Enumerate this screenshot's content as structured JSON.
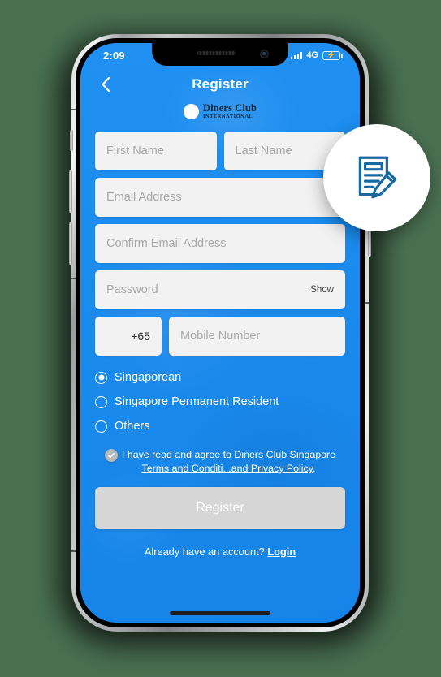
{
  "status_bar": {
    "time": "2:09",
    "network": "4G",
    "signal_icon": "signal-bars-icon",
    "battery_icon": "battery-charging-icon"
  },
  "nav": {
    "back_icon": "chevron-left-icon",
    "title": "Register"
  },
  "brand": {
    "logo_icon": "diners-club-split-circle-icon",
    "name": "Diners Club",
    "subtitle": "INTERNATIONAL"
  },
  "form": {
    "first_name_placeholder": "First Name",
    "last_name_placeholder": "Last Name",
    "email_placeholder": "Email Address",
    "confirm_email_placeholder": "Confirm Email Address",
    "password_placeholder": "Password",
    "show_password_label": "Show",
    "country_code": "+65",
    "mobile_placeholder": "Mobile Number"
  },
  "residency": {
    "options": [
      {
        "label": "Singaporean",
        "selected": true
      },
      {
        "label": "Singapore Permanent Resident",
        "selected": false
      },
      {
        "label": "Others",
        "selected": false
      }
    ]
  },
  "terms": {
    "checkbox_icon": "check-icon",
    "checked": true,
    "line1": "I have read and agree to Diners Club Singapore",
    "link": "Terms and Conditi...and Privacy Policy",
    "period": "."
  },
  "actions": {
    "register_label": "Register",
    "login_prompt": "Already have an account?",
    "login_label": "Login"
  },
  "badge": {
    "icon": "form-with-pencil-icon",
    "icon_color": "#17699f"
  },
  "colors": {
    "screen_blue": "#1a8cf0",
    "page_background": "#4a7052",
    "field_gray": "#f2f2f2",
    "button_disabled_gray": "#d6d6d6",
    "battery_green": "#31d158"
  }
}
